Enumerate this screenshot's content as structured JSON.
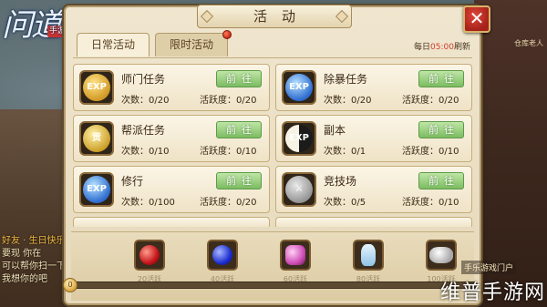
{
  "background": {
    "logo_text": "问道",
    "logo_tag": "手游",
    "npc_label": "仓库老人",
    "chat_lines": [
      "好友 · 生日快乐",
      "要现 你在",
      "可以帮你扫一下",
      "我想你的吧"
    ]
  },
  "panel": {
    "title": "活动",
    "close_label": "✕",
    "tabs": [
      {
        "label": "日常活动",
        "active": true
      },
      {
        "label": "限时活动",
        "active": false,
        "has_dot": true
      }
    ],
    "refresh": {
      "prefix": "每日",
      "time": "05:00",
      "suffix": "刷新"
    }
  },
  "activities": [
    {
      "name": "师门任务",
      "count": "次数：0/20",
      "activity": "活跃度：0/20",
      "button": "前往",
      "icon": "exp-gold-icon",
      "icon_text": "EXP"
    },
    {
      "name": "除暴任务",
      "count": "次数：0/20",
      "activity": "活跃度：0/20",
      "button": "前往",
      "icon": "exp-blue-icon",
      "icon_text": "EXP"
    },
    {
      "name": "帮派任务",
      "count": "次数：0/10",
      "activity": "活跃度：0/10",
      "button": "前往",
      "icon": "coin-icon",
      "icon_text": "贡"
    },
    {
      "name": "副本",
      "count": "次数：0/1",
      "activity": "活跃度：0/10",
      "button": "前往",
      "icon": "yinyang-icon",
      "icon_text": "EXP"
    },
    {
      "name": "修行",
      "count": "次数：0/100",
      "activity": "活跃度：0/20",
      "button": "前往",
      "icon": "exp-blue-icon",
      "icon_text": "EXP"
    },
    {
      "name": "竞技场",
      "count": "次数：0/5",
      "activity": "活跃度：0/10",
      "button": "前往",
      "icon": "swords-icon",
      "icon_text": "⚔"
    }
  ],
  "rewards": {
    "progress_value": "0",
    "progress_fraction": 0,
    "items": [
      {
        "label": "20活跃",
        "icon": "red-gem-icon"
      },
      {
        "label": "40活跃",
        "icon": "blue-gem-icon"
      },
      {
        "label": "60活跃",
        "icon": "pink-crystal-icon"
      },
      {
        "label": "80活跃",
        "icon": "vase-icon"
      },
      {
        "label": "100活跃",
        "icon": "silver-ingot-icon"
      }
    ]
  },
  "watermark": {
    "main": "维普手游网",
    "sub": "手乐游戏门户"
  }
}
